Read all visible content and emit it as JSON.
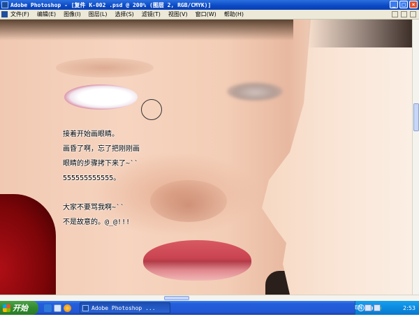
{
  "window": {
    "title": "Adobe Photoshop - [复件 K-002 .psd @ 200% (图层 2, RGB/CMYK)]",
    "minimize_glyph": "_",
    "maximize_glyph": "□",
    "close_glyph": "×"
  },
  "menubar": {
    "items": [
      {
        "label": "文件(F)"
      },
      {
        "label": "编辑(E)"
      },
      {
        "label": "图像(I)"
      },
      {
        "label": "图层(L)"
      },
      {
        "label": "选择(S)"
      },
      {
        "label": "滤镜(T)"
      },
      {
        "label": "视图(V)"
      },
      {
        "label": "窗口(W)"
      },
      {
        "label": "帮助(H)"
      }
    ]
  },
  "canvas": {
    "note_lines": [
      "接着开始画眼睛。",
      "画昏了啊，忘了把刚刚画",
      "眼睛的步骤拷下来了~``",
      "555555555555。",
      "",
      "大家不要骂我啊~``",
      "不是故意的。@_@!!!"
    ]
  },
  "taskbar": {
    "start_label": "开始",
    "task_item_label": "Adobe Photoshop ...",
    "language": "EN",
    "clock": "2:53"
  }
}
